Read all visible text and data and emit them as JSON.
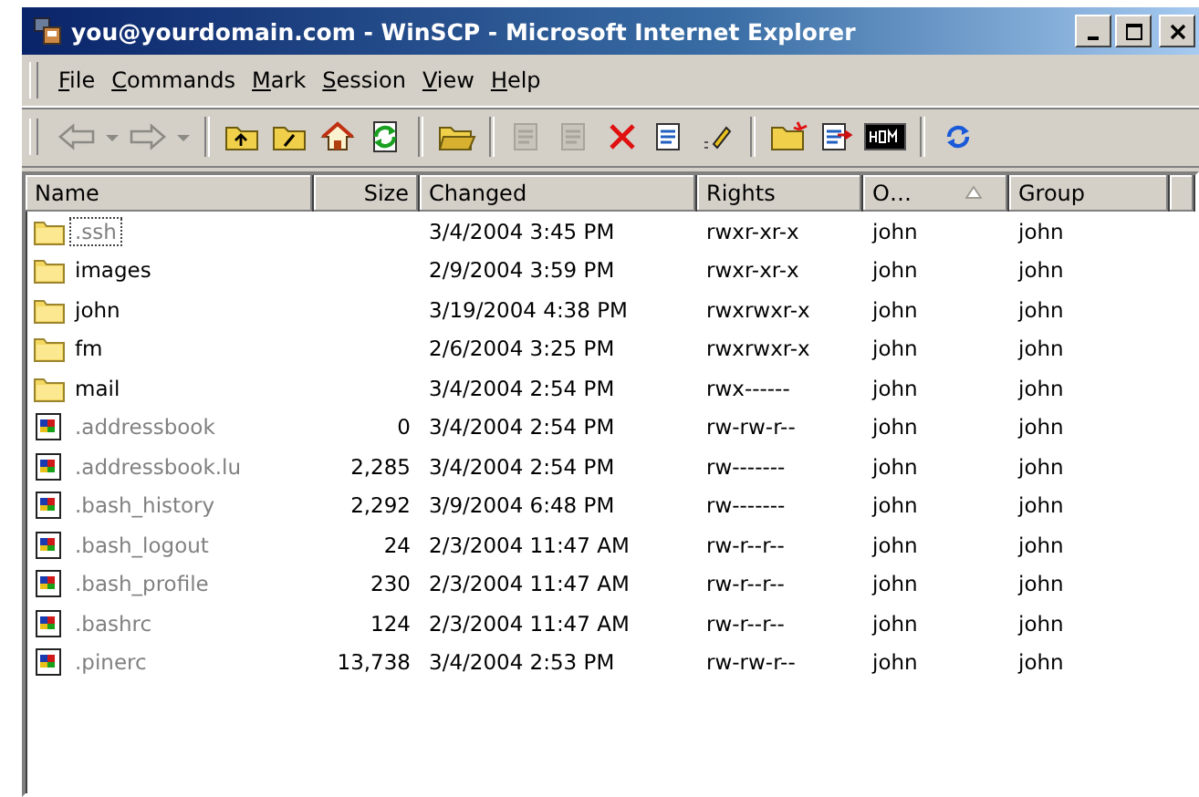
{
  "window": {
    "title": "you@yourdomain.com - WinSCP - Microsoft Internet Explorer"
  },
  "menu": [
    {
      "label": "File"
    },
    {
      "label": "Commands"
    },
    {
      "label": "Mark"
    },
    {
      "label": "Session"
    },
    {
      "label": "View"
    },
    {
      "label": "Help"
    }
  ],
  "toolbar_groups": [
    [
      {
        "kind": "back",
        "disabled": true
      },
      {
        "kind": "dropdown",
        "disabled": true
      },
      {
        "kind": "forward",
        "disabled": true
      },
      {
        "kind": "dropdown",
        "disabled": true
      }
    ],
    [
      {
        "kind": "parent",
        "disabled": false
      },
      {
        "kind": "root",
        "disabled": false
      },
      {
        "kind": "home",
        "disabled": false
      },
      {
        "kind": "refresh",
        "disabled": false
      }
    ],
    [
      {
        "kind": "open",
        "disabled": false
      }
    ],
    [
      {
        "kind": "edit",
        "disabled": true
      },
      {
        "kind": "copy",
        "disabled": true
      },
      {
        "kind": "delete",
        "disabled": false
      },
      {
        "kind": "properties",
        "disabled": false
      },
      {
        "kind": "rename",
        "disabled": false
      }
    ],
    [
      {
        "kind": "newfolder",
        "disabled": false
      },
      {
        "kind": "compare",
        "disabled": false
      },
      {
        "kind": "terminal",
        "disabled": false
      }
    ],
    [
      {
        "kind": "sync",
        "disabled": false
      }
    ]
  ],
  "table": {
    "columns": [
      {
        "label": "Name",
        "kind": "text",
        "sorted": false
      },
      {
        "label": "Size",
        "kind": "number",
        "sorted": false
      },
      {
        "label": "Changed",
        "kind": "text",
        "sorted": false
      },
      {
        "label": "Rights",
        "kind": "text",
        "sorted": false
      },
      {
        "label": "O…",
        "kind": "text",
        "sorted": true
      },
      {
        "label": "Group",
        "kind": "text",
        "sorted": false
      }
    ],
    "rows": [
      {
        "kind": "folder",
        "hidden": true,
        "focused": true,
        "name": ".ssh",
        "size": "",
        "changed": "3/4/2004 3:45 PM",
        "rights": "rwxr-xr-x",
        "owner": "john",
        "group": "john"
      },
      {
        "kind": "folder",
        "hidden": false,
        "focused": false,
        "name": "images",
        "size": "",
        "changed": "2/9/2004 3:59 PM",
        "rights": "rwxr-xr-x",
        "owner": "john",
        "group": "john"
      },
      {
        "kind": "folder",
        "hidden": false,
        "focused": false,
        "name": "john",
        "size": "",
        "changed": "3/19/2004 4:38 PM",
        "rights": "rwxrwxr-x",
        "owner": "john",
        "group": "john"
      },
      {
        "kind": "folder",
        "hidden": false,
        "focused": false,
        "name": "fm",
        "size": "",
        "changed": "2/6/2004 3:25 PM",
        "rights": "rwxrwxr-x",
        "owner": "john",
        "group": "john"
      },
      {
        "kind": "folder",
        "hidden": false,
        "focused": false,
        "name": "mail",
        "size": "",
        "changed": "3/4/2004 2:54 PM",
        "rights": "rwx------",
        "owner": "john",
        "group": "john"
      },
      {
        "kind": "file",
        "hidden": true,
        "focused": false,
        "name": ".addressbook",
        "size": "0",
        "changed": "3/4/2004 2:54 PM",
        "rights": "rw-rw-r--",
        "owner": "john",
        "group": "john"
      },
      {
        "kind": "file",
        "hidden": true,
        "focused": false,
        "name": ".addressbook.lu",
        "size": "2,285",
        "changed": "3/4/2004 2:54 PM",
        "rights": "rw-------",
        "owner": "john",
        "group": "john"
      },
      {
        "kind": "file",
        "hidden": true,
        "focused": false,
        "name": ".bash_history",
        "size": "2,292",
        "changed": "3/9/2004 6:48 PM",
        "rights": "rw-------",
        "owner": "john",
        "group": "john"
      },
      {
        "kind": "file",
        "hidden": true,
        "focused": false,
        "name": ".bash_logout",
        "size": "24",
        "changed": "2/3/2004 11:47 AM",
        "rights": "rw-r--r--",
        "owner": "john",
        "group": "john"
      },
      {
        "kind": "file",
        "hidden": true,
        "focused": false,
        "name": ".bash_profile",
        "size": "230",
        "changed": "2/3/2004 11:47 AM",
        "rights": "rw-r--r--",
        "owner": "john",
        "group": "john"
      },
      {
        "kind": "file",
        "hidden": true,
        "focused": false,
        "name": ".bashrc",
        "size": "124",
        "changed": "2/3/2004 11:47 AM",
        "rights": "rw-r--r--",
        "owner": "john",
        "group": "john"
      },
      {
        "kind": "file",
        "hidden": true,
        "focused": false,
        "name": ".pinerc",
        "size": "13,738",
        "changed": "3/4/2004 2:53 PM",
        "rights": "rw-rw-r--",
        "owner": "john",
        "group": "john"
      }
    ]
  }
}
